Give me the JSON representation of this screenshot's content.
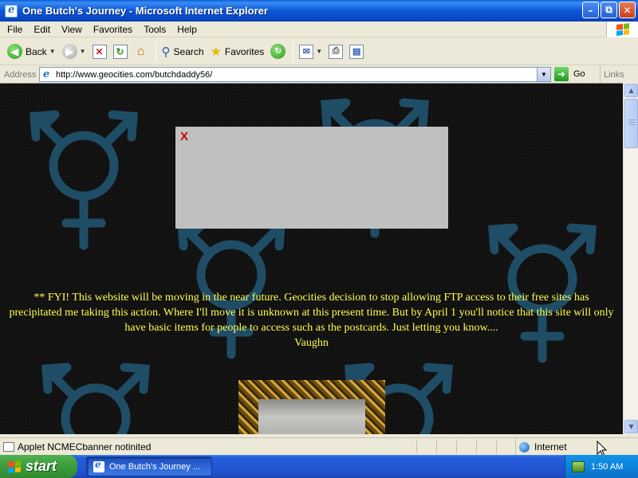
{
  "window": {
    "title": "One Butch's Journey - Microsoft Internet Explorer",
    "minimize": "–",
    "maximize": "⧉",
    "close": "✕"
  },
  "menu": [
    "File",
    "Edit",
    "View",
    "Favorites",
    "Tools",
    "Help"
  ],
  "toolbar": {
    "back_label": "Back",
    "search_label": "Search",
    "favorites_label": "Favorites"
  },
  "address": {
    "label": "Address",
    "url": "http://www.geocities.com/butchdaddy56/",
    "go_label": "Go",
    "links_label": "Links"
  },
  "page": {
    "ad_close": "X",
    "notice_text": "** FYI! This website will be moving in the near future. Geocities decision to stop allowing FTP access to their free sites has precipitated me taking this action. Where I'll move it is unknown at this present time. But by April 1 you'll notice that this site will only have basic items for people to access such as the postcards. Just letting you know....",
    "signature": "Vaughn"
  },
  "status": {
    "text": "Applet NCMECbanner notinited",
    "zone": "Internet"
  },
  "taskbar": {
    "start_label": "start",
    "task_label": "One Butch's Journey ...",
    "clock": "1:50 AM"
  },
  "colors": {
    "notice_text": "#ffff4d",
    "page_bg": "#111111",
    "symbol": "#1f4d66",
    "ad_bg": "#c0c0c0"
  }
}
